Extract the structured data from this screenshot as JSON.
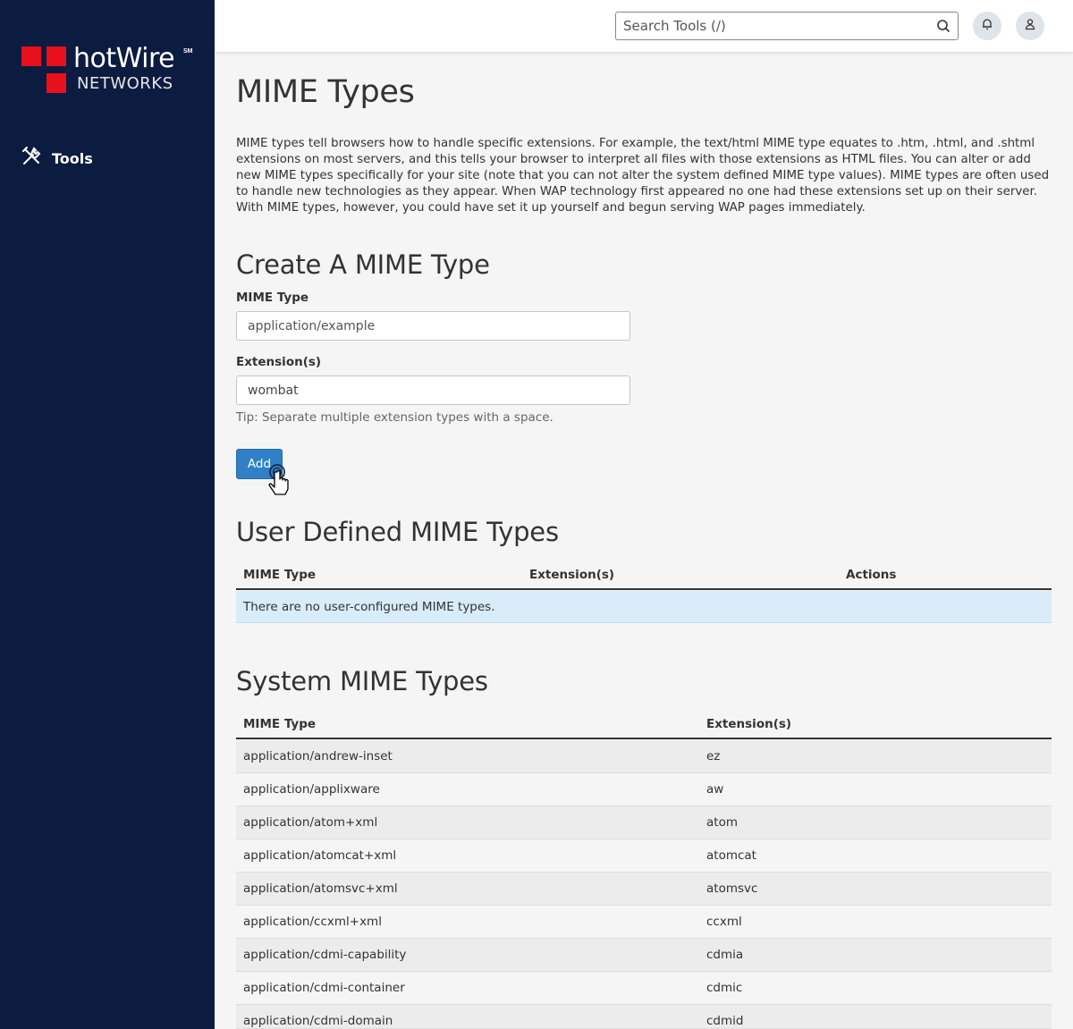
{
  "brand": {
    "name": "hotWire",
    "mark": "SM",
    "sub": "NETWORKS",
    "color": "#e8101c"
  },
  "sidebar": {
    "items": [
      {
        "label": "Tools",
        "icon": "tools-icon"
      }
    ]
  },
  "header": {
    "search_placeholder": "Search Tools (/)",
    "icons": [
      "search-icon",
      "bell-icon",
      "user-icon"
    ]
  },
  "page": {
    "title": "MIME Types",
    "intro": "MIME types tell browsers how to handle specific extensions. For example, the text/html MIME type equates to .htm, .html, and .shtml extensions on most servers, and this tells your browser to interpret all files with those extensions as HTML files. You can alter or add new MIME types specifically for your site (note that you can not alter the system defined MIME type values). MIME types are often used to handle new technologies as they appear. When WAP technology first appeared no one had these extensions set up on their server. With MIME types, however, you could have set it up yourself and begun serving WAP pages immediately."
  },
  "create": {
    "heading": "Create A MIME Type",
    "mime_label": "MIME Type",
    "mime_placeholder": "application/example",
    "ext_label": "Extension(s)",
    "ext_value": "wombat",
    "tip": "Tip: Separate multiple extension types with a space.",
    "add_label": "Add"
  },
  "user_defined": {
    "heading": "User Defined MIME Types",
    "columns": [
      "MIME Type",
      "Extension(s)",
      "Actions"
    ],
    "empty_message": "There are no user-configured MIME types."
  },
  "system": {
    "heading": "System MIME Types",
    "columns": [
      "MIME Type",
      "Extension(s)"
    ],
    "rows": [
      [
        "application/andrew-inset",
        "ez"
      ],
      [
        "application/applixware",
        "aw"
      ],
      [
        "application/atom+xml",
        "atom"
      ],
      [
        "application/atomcat+xml",
        "atomcat"
      ],
      [
        "application/atomsvc+xml",
        "atomsvc"
      ],
      [
        "application/ccxml+xml",
        "ccxml"
      ],
      [
        "application/cdmi-capability",
        "cdmia"
      ],
      [
        "application/cdmi-container",
        "cdmic"
      ],
      [
        "application/cdmi-domain",
        "cdmid"
      ]
    ]
  },
  "colors": {
    "sidebar": "#0c1b40",
    "button": "#2f80c6",
    "empty_row": "#d9ecf9"
  }
}
